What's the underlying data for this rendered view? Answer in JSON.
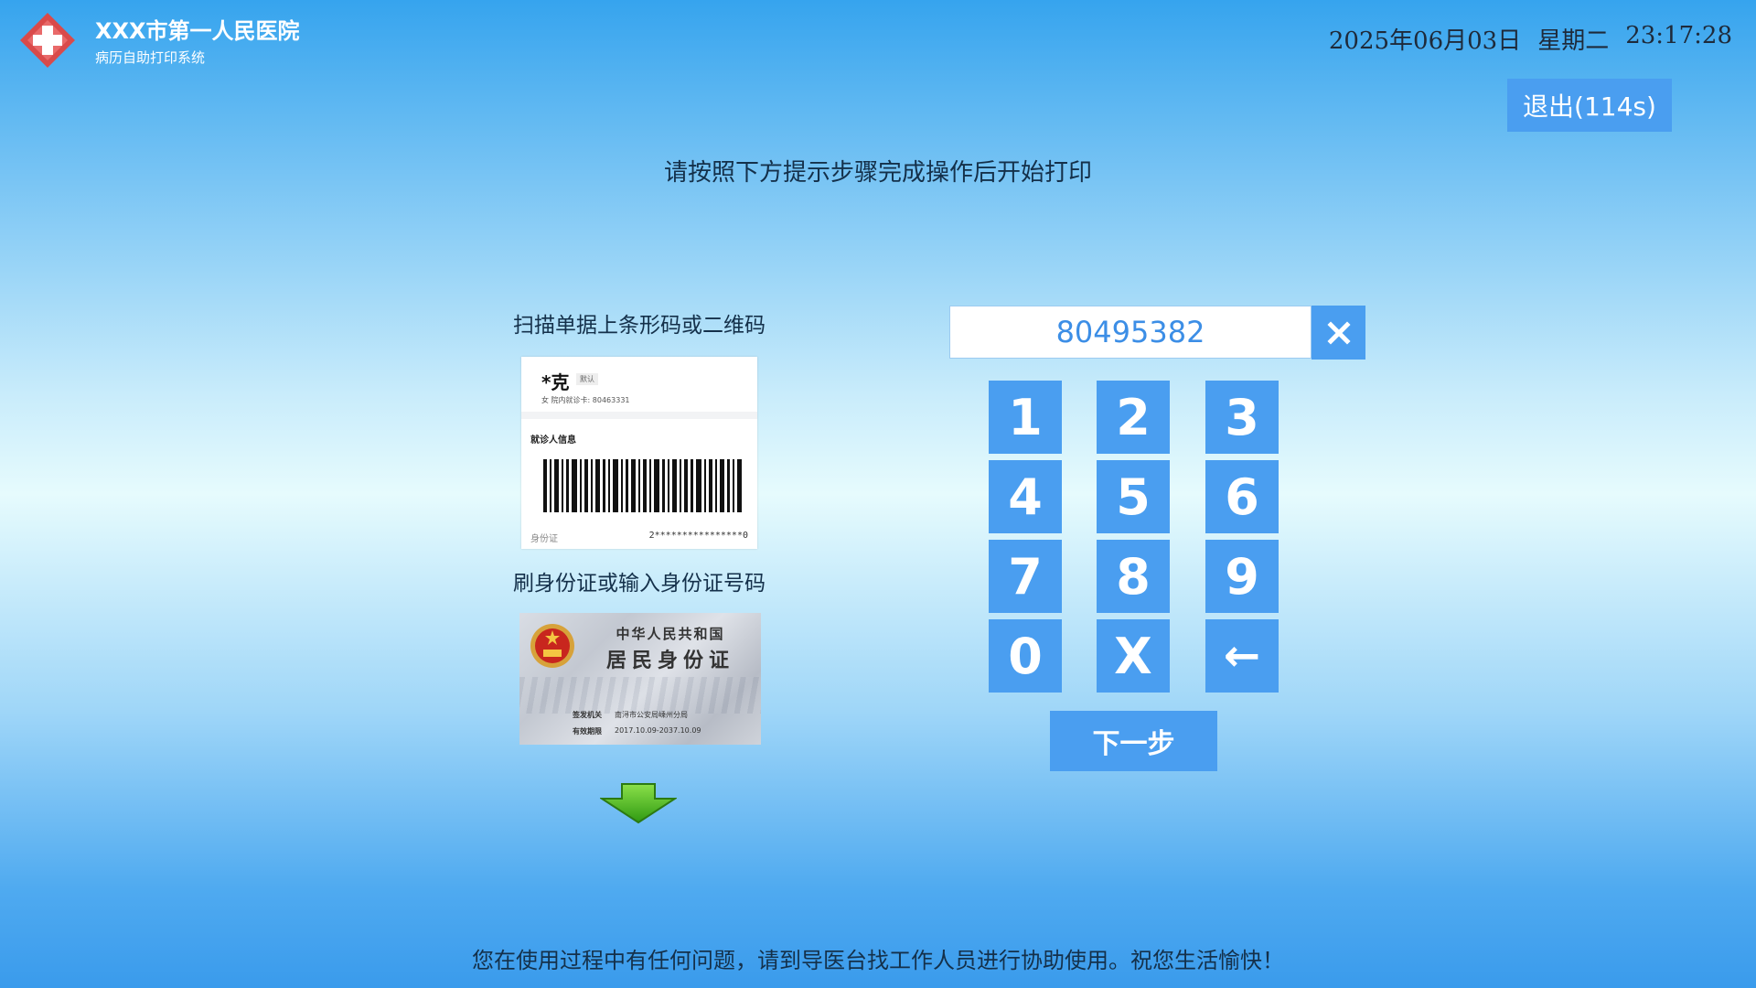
{
  "header": {
    "hospital_name": "XXX市第一人民医院",
    "system_name": "病历自助打印系统",
    "date": "2025年06月03日",
    "weekday": "星期二",
    "time": "23:17:28",
    "exit_label": "退出(114s)"
  },
  "instruction": "请按照下方提示步骤完成操作后开始打印",
  "scan_section": {
    "label": "扫描单据上条形码或二维码",
    "card": {
      "name": "*克",
      "tag": "默认",
      "meta": "女    院内就诊卡: 80463331",
      "section_title": "就诊人信息",
      "id_label": "身份证",
      "id_value": "2****************0"
    }
  },
  "id_section": {
    "label": "刷身份证或输入身份证号码",
    "card": {
      "country": "中华人民共和国",
      "title": "居民身份证",
      "issuer_label": "签发机关",
      "issuer_value": "南浔市公安局嵊州分局",
      "validity_label": "有效期限",
      "validity_value": "2017.10.09-2037.10.09"
    }
  },
  "input": {
    "value": "80495382"
  },
  "keypad": {
    "keys": [
      "1",
      "2",
      "3",
      "4",
      "5",
      "6",
      "7",
      "8",
      "9",
      "0",
      "X",
      "←"
    ],
    "next_label": "下一步"
  },
  "footer": "您在使用过程中有任何问题，请到导医台找工作人员进行协助使用。祝您生活愉快！",
  "colors": {
    "accent": "#4a9ef0",
    "input_text": "#3c8ee6",
    "logo_red": "#d94a4a",
    "arrow_green": "#3fb51b"
  }
}
